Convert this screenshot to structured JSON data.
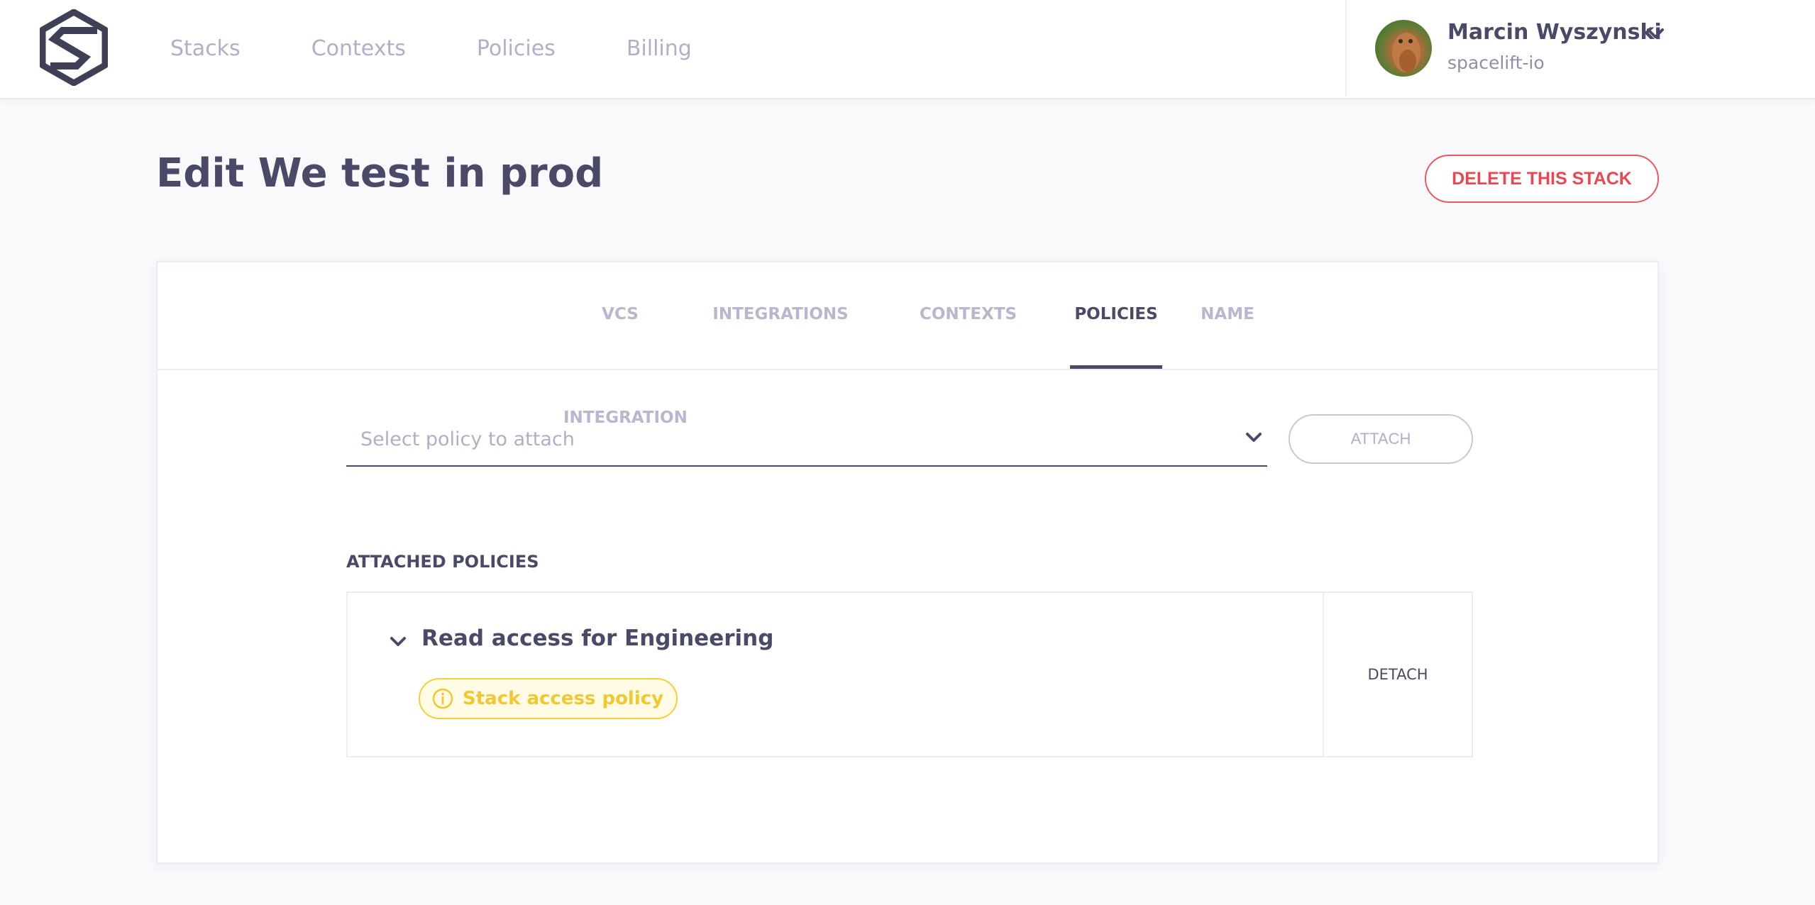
{
  "nav": {
    "items": [
      {
        "label": "Stacks"
      },
      {
        "label": "Contexts"
      },
      {
        "label": "Policies"
      },
      {
        "label": "Billing"
      }
    ]
  },
  "user": {
    "name": "Marcin Wyszynski",
    "org": "spacelift-io"
  },
  "page": {
    "title": "Edit We test in prod",
    "delete_label": "DELETE THIS STACK"
  },
  "tabs": [
    {
      "label": "VCS INTEGRATION",
      "active": false
    },
    {
      "label": "INTEGRATIONS",
      "active": false
    },
    {
      "label": "CONTEXTS",
      "active": false
    },
    {
      "label": "POLICIES",
      "active": true
    },
    {
      "label": "NAME",
      "active": false
    }
  ],
  "policy_select": {
    "placeholder": "Select policy to attach",
    "attach_label": "ATTACH"
  },
  "attached": {
    "title": "ATTACHED POLICIES",
    "policies": [
      {
        "name": "Read access for Engineering",
        "type": "Stack access policy",
        "detach_label": "DETACH"
      }
    ]
  },
  "icons": {
    "logo": "spacelift-logo",
    "user_menu": "chevron-down-icon",
    "select": "chevron-down-icon",
    "policy_toggle": "chevron-down-icon",
    "badge": "info-circle-icon"
  },
  "colors": {
    "text": "#4a4a68",
    "muted": "#b0afca",
    "danger": "#e84850",
    "warning": "#f2c830"
  }
}
